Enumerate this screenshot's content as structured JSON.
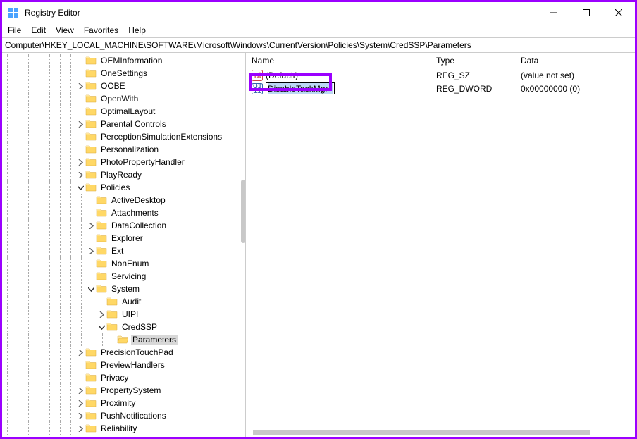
{
  "window": {
    "title": "Registry Editor"
  },
  "menu": {
    "file": "File",
    "edit": "Edit",
    "view": "View",
    "favorites": "Favorites",
    "help": "Help"
  },
  "address": {
    "path": "Computer\\HKEY_LOCAL_MACHINE\\SOFTWARE\\Microsoft\\Windows\\CurrentVersion\\Policies\\System\\CredSSP\\Parameters"
  },
  "tree": {
    "items": [
      {
        "indent": 7,
        "expander": "none",
        "label": "OEMInformation"
      },
      {
        "indent": 7,
        "expander": "none",
        "label": "OneSettings"
      },
      {
        "indent": 7,
        "expander": "right",
        "label": "OOBE"
      },
      {
        "indent": 7,
        "expander": "none",
        "label": "OpenWith"
      },
      {
        "indent": 7,
        "expander": "none",
        "label": "OptimalLayout"
      },
      {
        "indent": 7,
        "expander": "right",
        "label": "Parental Controls"
      },
      {
        "indent": 7,
        "expander": "none",
        "label": "PerceptionSimulationExtensions"
      },
      {
        "indent": 7,
        "expander": "none",
        "label": "Personalization"
      },
      {
        "indent": 7,
        "expander": "right",
        "label": "PhotoPropertyHandler"
      },
      {
        "indent": 7,
        "expander": "right",
        "label": "PlayReady"
      },
      {
        "indent": 7,
        "expander": "down",
        "label": "Policies"
      },
      {
        "indent": 8,
        "expander": "none",
        "label": "ActiveDesktop"
      },
      {
        "indent": 8,
        "expander": "none",
        "label": "Attachments"
      },
      {
        "indent": 8,
        "expander": "right",
        "label": "DataCollection"
      },
      {
        "indent": 8,
        "expander": "none",
        "label": "Explorer"
      },
      {
        "indent": 8,
        "expander": "right",
        "label": "Ext"
      },
      {
        "indent": 8,
        "expander": "none",
        "label": "NonEnum"
      },
      {
        "indent": 8,
        "expander": "none",
        "label": "Servicing"
      },
      {
        "indent": 8,
        "expander": "down",
        "label": "System"
      },
      {
        "indent": 9,
        "expander": "none",
        "label": "Audit"
      },
      {
        "indent": 9,
        "expander": "right",
        "label": "UIPI"
      },
      {
        "indent": 9,
        "expander": "down",
        "label": "CredSSP"
      },
      {
        "indent": 10,
        "expander": "none",
        "label": "Parameters",
        "selected": true
      },
      {
        "indent": 7,
        "expander": "right",
        "label": "PrecisionTouchPad"
      },
      {
        "indent": 7,
        "expander": "none",
        "label": "PreviewHandlers"
      },
      {
        "indent": 7,
        "expander": "none",
        "label": "Privacy"
      },
      {
        "indent": 7,
        "expander": "right",
        "label": "PropertySystem"
      },
      {
        "indent": 7,
        "expander": "right",
        "label": "Proximity"
      },
      {
        "indent": 7,
        "expander": "right",
        "label": "PushNotifications"
      },
      {
        "indent": 7,
        "expander": "right",
        "label": "Reliability"
      }
    ]
  },
  "list": {
    "headers": {
      "name": "Name",
      "type": "Type",
      "data": "Data"
    },
    "rows": [
      {
        "icon": "string",
        "name": "(Default)",
        "type": "REG_SZ",
        "data": "(value not set)",
        "rename": false
      },
      {
        "icon": "dword",
        "name": "DisableTaskMgr",
        "type": "REG_DWORD",
        "data": "0x00000000 (0)",
        "rename": true
      }
    ]
  }
}
